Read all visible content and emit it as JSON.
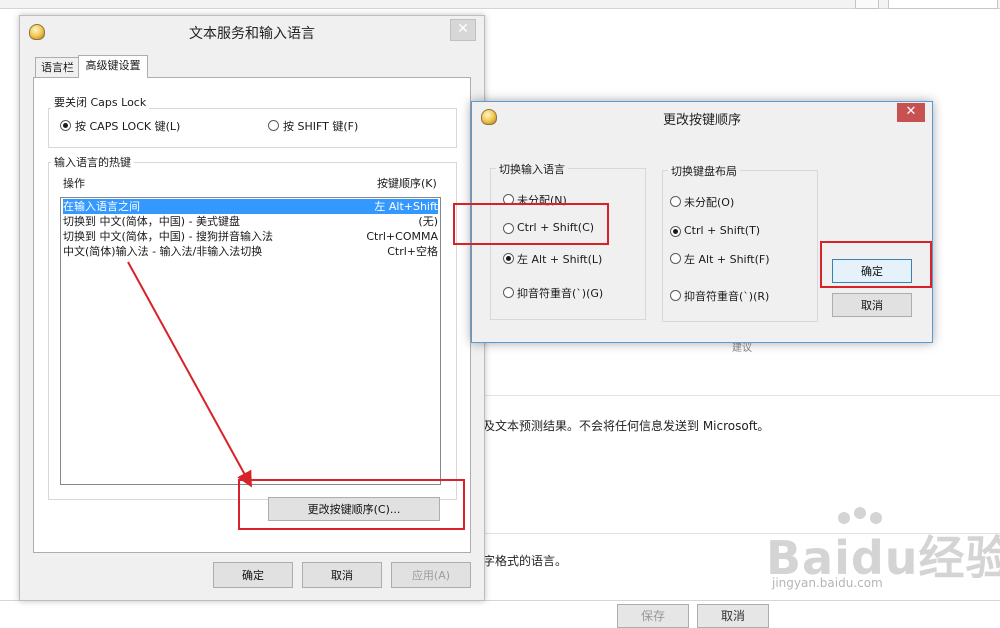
{
  "background": {
    "line1": "及文本预测结果。不会将任何信息发送到 Microsoft。",
    "line2": "字格式的语言。",
    "snippet": "建议",
    "save_label": "保存",
    "cancel_label": "取消"
  },
  "main_window": {
    "title": "文本服务和输入语言",
    "close_label": "✕",
    "tabs": [
      {
        "label": "语言栏"
      },
      {
        "label": "高级键设置"
      }
    ],
    "capslock_group": {
      "legend": "要关闭 Caps Lock",
      "options": [
        {
          "label": "按 CAPS LOCK 键(L)"
        },
        {
          "label": "按 SHIFT 键(F)"
        }
      ]
    },
    "hotkey_group": {
      "legend": "输入语言的热键",
      "col_action": "操作",
      "col_keys": "按键顺序(K)",
      "rows": [
        {
          "action": "在输入语言之间",
          "keys": "左 Alt+Shift"
        },
        {
          "action": "切换到 中文(简体，中国) - 美式键盘",
          "keys": "(无)"
        },
        {
          "action": "切换到 中文(简体，中国) - 搜狗拼音输入法",
          "keys": "Ctrl+COMMA"
        },
        {
          "action": "中文(简体)输入法 - 输入法/非输入法切换",
          "keys": "Ctrl+空格"
        }
      ],
      "change_button": "更改按键顺序(C)..."
    },
    "ok_label": "确定",
    "cancel_label": "取消",
    "apply_label": "应用(A)"
  },
  "change_dialog": {
    "title": "更改按键顺序",
    "close_label": "✕",
    "switch_language": {
      "legend": "切换输入语言",
      "options": [
        {
          "label": "未分配(N)"
        },
        {
          "label": "Ctrl + Shift(C)"
        },
        {
          "label": "左 Alt + Shift(L)"
        },
        {
          "label": "抑音符重音(`)(G)"
        }
      ]
    },
    "switch_layout": {
      "legend": "切换键盘布局",
      "options": [
        {
          "label": "未分配(O)"
        },
        {
          "label": "Ctrl + Shift(T)"
        },
        {
          "label": "左 Alt + Shift(F)"
        },
        {
          "label": "抑音符重音(`)(R)"
        }
      ]
    },
    "ok_label": "确定",
    "cancel_label": "取消"
  },
  "watermark": {
    "brand": "Baidu经验",
    "url": "jingyan.baidu.com"
  },
  "colors": {
    "selection": "#3399ff",
    "highlight_red": "#d8222a",
    "close_red": "#c75050"
  }
}
